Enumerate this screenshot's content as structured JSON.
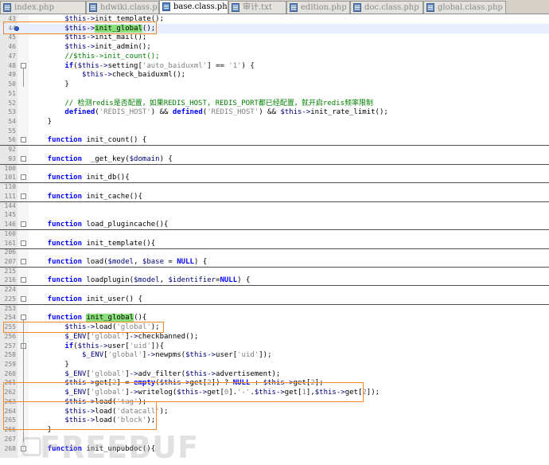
{
  "tabs": [
    {
      "label": "index.php",
      "active": false
    },
    {
      "label": "hdwiki.class.php",
      "active": false
    },
    {
      "label": "base.class.php",
      "active": true
    },
    {
      "label": "审计.txt",
      "active": false
    },
    {
      "label": "edition.php",
      "active": false
    },
    {
      "label": "doc.class.php",
      "active": false
    },
    {
      "label": "global.class.php",
      "active": false
    }
  ],
  "lines": [
    {
      "num": "43",
      "code": [
        [
          "var",
          "        $this"
        ],
        [
          "op",
          "->"
        ],
        [
          "t",
          "init_template();"
        ]
      ]
    },
    {
      "num": "44",
      "bookmark": true,
      "current": true,
      "code": [
        [
          "var",
          "        $this"
        ],
        [
          "op",
          "->"
        ],
        [
          "hl",
          "init_global"
        ],
        [
          "t",
          "();"
        ]
      ]
    },
    {
      "num": "45",
      "code": [
        [
          "var",
          "        $this"
        ],
        [
          "op",
          "->"
        ],
        [
          "t",
          "init_mail();"
        ]
      ]
    },
    {
      "num": "46",
      "code": [
        [
          "var",
          "        $this"
        ],
        [
          "op",
          "->"
        ],
        [
          "t",
          "init_admin();"
        ]
      ]
    },
    {
      "num": "47",
      "code": [
        [
          "cm",
          "        //$this->init_count();"
        ]
      ]
    },
    {
      "num": "48",
      "fold": "-",
      "code": [
        [
          "kw",
          "        if"
        ],
        [
          "t",
          "("
        ],
        [
          "var",
          "$this"
        ],
        [
          "op",
          "->"
        ],
        [
          "t",
          "setting["
        ],
        [
          "str",
          "'auto_baiduxml'"
        ],
        [
          "t",
          "] == "
        ],
        [
          "str",
          "'1'"
        ],
        [
          "t",
          ") {"
        ]
      ]
    },
    {
      "num": "49",
      "code": [
        [
          "var",
          "            $this"
        ],
        [
          "op",
          "->"
        ],
        [
          "t",
          "check_baiduxml();"
        ]
      ]
    },
    {
      "num": "50",
      "code": [
        [
          "t",
          "        }"
        ]
      ]
    },
    {
      "num": "51",
      "code": [
        [
          "t",
          ""
        ]
      ]
    },
    {
      "num": "52",
      "code": [
        [
          "cm",
          "        // 检测redis是否配置，如果REDIS_HOST, REDIS_PORT都已经配置，就开启redis频率限制"
        ]
      ]
    },
    {
      "num": "53",
      "code": [
        [
          "kw",
          "        defined"
        ],
        [
          "t",
          "("
        ],
        [
          "str",
          "'REDIS_HOST'"
        ],
        [
          "t",
          ") && "
        ],
        [
          "kw",
          "defined"
        ],
        [
          "t",
          "("
        ],
        [
          "str",
          "'REDIS_HOST'"
        ],
        [
          "t",
          ") && "
        ],
        [
          "var",
          "$this"
        ],
        [
          "op",
          "->"
        ],
        [
          "t",
          "init_rate_limit();"
        ]
      ]
    },
    {
      "num": "54",
      "code": [
        [
          "t",
          "    }"
        ]
      ]
    },
    {
      "num": "55",
      "code": [
        [
          "t",
          ""
        ]
      ]
    },
    {
      "num": "56",
      "fold": "+",
      "sep": true,
      "code": [
        [
          "kw",
          "    function"
        ],
        [
          "t",
          " init_count() {"
        ]
      ]
    },
    {
      "num": "92",
      "code": [
        [
          "t",
          ""
        ]
      ]
    },
    {
      "num": "93",
      "fold": "+",
      "sep": true,
      "code": [
        [
          "kw",
          "    function"
        ],
        [
          "t",
          "  _get_key("
        ],
        [
          "var",
          "$domain"
        ],
        [
          "t",
          ") {"
        ]
      ]
    },
    {
      "num": "100",
      "code": [
        [
          "t",
          ""
        ]
      ]
    },
    {
      "num": "101",
      "fold": "+",
      "sep": true,
      "code": [
        [
          "kw",
          "    function"
        ],
        [
          "t",
          " init_db(){"
        ]
      ]
    },
    {
      "num": "110",
      "code": [
        [
          "t",
          ""
        ]
      ]
    },
    {
      "num": "111",
      "fold": "+",
      "sep": true,
      "code": [
        [
          "kw",
          "    function"
        ],
        [
          "t",
          " init_cache(){"
        ]
      ]
    },
    {
      "num": "144",
      "code": [
        [
          "t",
          ""
        ]
      ]
    },
    {
      "num": "145",
      "code": [
        [
          "t",
          ""
        ]
      ]
    },
    {
      "num": "146",
      "fold": "+",
      "sep": true,
      "code": [
        [
          "kw",
          "    function"
        ],
        [
          "t",
          " load_plugincache(){"
        ]
      ]
    },
    {
      "num": "160",
      "code": [
        [
          "t",
          ""
        ]
      ]
    },
    {
      "num": "161",
      "fold": "+",
      "sep": true,
      "code": [
        [
          "kw",
          "    function"
        ],
        [
          "t",
          " init_template(){"
        ]
      ]
    },
    {
      "num": "206",
      "code": [
        [
          "t",
          ""
        ]
      ]
    },
    {
      "num": "207",
      "fold": "+",
      "sep": true,
      "code": [
        [
          "kw",
          "    function"
        ],
        [
          "t",
          " load("
        ],
        [
          "var",
          "$model"
        ],
        [
          "t",
          ", "
        ],
        [
          "var",
          "$base"
        ],
        [
          "t",
          " = "
        ],
        [
          "kw",
          "NULL"
        ],
        [
          "t",
          ") {"
        ]
      ]
    },
    {
      "num": "215",
      "code": [
        [
          "t",
          ""
        ]
      ]
    },
    {
      "num": "216",
      "fold": "+",
      "sep": true,
      "code": [
        [
          "kw",
          "    function"
        ],
        [
          "t",
          " loadplugin("
        ],
        [
          "var",
          "$model"
        ],
        [
          "t",
          ", "
        ],
        [
          "var",
          "$identifier"
        ],
        [
          "t",
          "="
        ],
        [
          "kw",
          "NULL"
        ],
        [
          "t",
          ") {"
        ]
      ]
    },
    {
      "num": "224",
      "code": [
        [
          "t",
          ""
        ]
      ]
    },
    {
      "num": "225",
      "fold": "+",
      "sep": true,
      "code": [
        [
          "kw",
          "    function"
        ],
        [
          "t",
          " init_user() {"
        ]
      ]
    },
    {
      "num": "253",
      "code": [
        [
          "t",
          ""
        ]
      ]
    },
    {
      "num": "254",
      "fold": "-",
      "code": [
        [
          "kw",
          "    function"
        ],
        [
          "t",
          " "
        ],
        [
          "hl",
          "init_global"
        ],
        [
          "t",
          "(){"
        ]
      ]
    },
    {
      "num": "255",
      "code": [
        [
          "var",
          "        $this"
        ],
        [
          "op",
          "->"
        ],
        [
          "t",
          "load("
        ],
        [
          "str",
          "'global'"
        ],
        [
          "t",
          ");"
        ]
      ]
    },
    {
      "num": "256",
      "code": [
        [
          "var",
          "        $_ENV"
        ],
        [
          "t",
          "["
        ],
        [
          "str",
          "'global'"
        ],
        [
          "t",
          "]"
        ],
        [
          "op",
          "->"
        ],
        [
          "t",
          "checkbanned();"
        ]
      ]
    },
    {
      "num": "257",
      "fold": "-",
      "code": [
        [
          "kw",
          "        if"
        ],
        [
          "t",
          "("
        ],
        [
          "var",
          "$this"
        ],
        [
          "op",
          "->"
        ],
        [
          "t",
          "user["
        ],
        [
          "str",
          "'uid'"
        ],
        [
          "t",
          "]){"
        ]
      ]
    },
    {
      "num": "258",
      "code": [
        [
          "var",
          "            $_ENV"
        ],
        [
          "t",
          "["
        ],
        [
          "str",
          "'global'"
        ],
        [
          "t",
          "]"
        ],
        [
          "op",
          "->"
        ],
        [
          "t",
          "newpms("
        ],
        [
          "var",
          "$this"
        ],
        [
          "op",
          "->"
        ],
        [
          "t",
          "user["
        ],
        [
          "str",
          "'uid'"
        ],
        [
          "t",
          "]);"
        ]
      ]
    },
    {
      "num": "259",
      "code": [
        [
          "t",
          "        }"
        ]
      ]
    },
    {
      "num": "260",
      "code": [
        [
          "var",
          "        $_ENV"
        ],
        [
          "t",
          "["
        ],
        [
          "str",
          "'global'"
        ],
        [
          "t",
          "]"
        ],
        [
          "op",
          "->"
        ],
        [
          "t",
          "adv_filter("
        ],
        [
          "var",
          "$this"
        ],
        [
          "op",
          "->"
        ],
        [
          "t",
          "advertisement);"
        ]
      ]
    },
    {
      "num": "261",
      "code": [
        [
          "var",
          "        $this"
        ],
        [
          "op",
          "->"
        ],
        [
          "t",
          "get["
        ],
        [
          "str",
          "2"
        ],
        [
          "t",
          "] = "
        ],
        [
          "kw",
          "empty"
        ],
        [
          "t",
          "("
        ],
        [
          "var",
          "$this"
        ],
        [
          "op",
          "->"
        ],
        [
          "t",
          "get["
        ],
        [
          "str",
          "2"
        ],
        [
          "t",
          "]) ? "
        ],
        [
          "kw",
          "NULL"
        ],
        [
          "t",
          " : "
        ],
        [
          "var",
          "$this"
        ],
        [
          "op",
          "->"
        ],
        [
          "t",
          "get["
        ],
        [
          "str",
          "2"
        ],
        [
          "t",
          "];"
        ]
      ]
    },
    {
      "num": "262",
      "code": [
        [
          "var",
          "        $_ENV"
        ],
        [
          "t",
          "["
        ],
        [
          "str",
          "'global'"
        ],
        [
          "t",
          "]"
        ],
        [
          "op",
          "->"
        ],
        [
          "t",
          "writelog("
        ],
        [
          "var",
          "$this"
        ],
        [
          "op",
          "->"
        ],
        [
          "t",
          "get["
        ],
        [
          "str",
          "0"
        ],
        [
          "t",
          "]."
        ],
        [
          "str",
          "'-'"
        ],
        [
          "t",
          "."
        ],
        [
          "var",
          "$this"
        ],
        [
          "op",
          "->"
        ],
        [
          "t",
          "get["
        ],
        [
          "str",
          "1"
        ],
        [
          "t",
          "],"
        ],
        [
          "var",
          "$this"
        ],
        [
          "op",
          "->"
        ],
        [
          "t",
          "get["
        ],
        [
          "str",
          "2"
        ],
        [
          "t",
          "]);"
        ]
      ]
    },
    {
      "num": "263",
      "code": [
        [
          "var",
          "        $this"
        ],
        [
          "op",
          "->"
        ],
        [
          "t",
          "load("
        ],
        [
          "str",
          "'tag'"
        ],
        [
          "t",
          ");"
        ]
      ]
    },
    {
      "num": "264",
      "code": [
        [
          "var",
          "        $this"
        ],
        [
          "op",
          "->"
        ],
        [
          "t",
          "load("
        ],
        [
          "str",
          "'datacall'"
        ],
        [
          "t",
          ");"
        ]
      ]
    },
    {
      "num": "265",
      "code": [
        [
          "var",
          "        $this"
        ],
        [
          "op",
          "->"
        ],
        [
          "t",
          "load("
        ],
        [
          "str",
          "'block'"
        ],
        [
          "t",
          ");"
        ]
      ]
    },
    {
      "num": "266",
      "code": [
        [
          "t",
          "    }"
        ]
      ]
    },
    {
      "num": "267",
      "code": [
        [
          "t",
          ""
        ]
      ]
    },
    {
      "num": "268",
      "fold": "+",
      "code": [
        [
          "kw",
          "    function"
        ],
        [
          "t",
          " init_unpubdoc(){"
        ]
      ]
    }
  ],
  "colors": {
    "keyword": "#0000ff",
    "variable": "#000080",
    "string": "#808080",
    "comment": "#008000",
    "highlight": "#8ae07a",
    "annotation": "#ef8a2b"
  },
  "watermark": "FREEBUF"
}
